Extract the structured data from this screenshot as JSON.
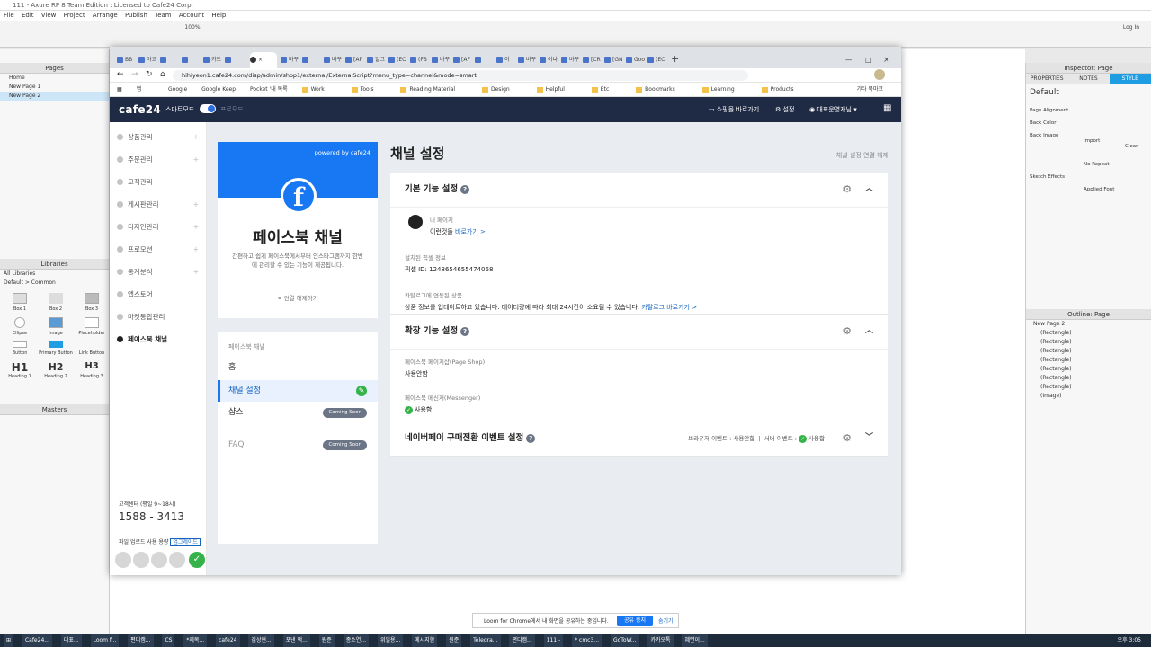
{
  "axure": {
    "title": "111 - Axure RP 8 Team Edition : Licensed to Cafe24 Corp.",
    "menu": [
      "File",
      "Edit",
      "View",
      "Project",
      "Arrange",
      "Publish",
      "Team",
      "Account",
      "Help"
    ],
    "zoom": "100%",
    "log_in": "Log In",
    "pages_header": "Pages",
    "pages": [
      "Home",
      "New Page 1",
      "New Page 2"
    ],
    "libraries_header": "Libraries",
    "all_libraries": "All Libraries",
    "default_common": "Default > Common",
    "widgets": [
      "Box 1",
      "Box 2",
      "Box 3",
      "Ellipse",
      "Image",
      "Placeholder",
      "Button",
      "Primary Button",
      "Link Button",
      "Heading 1",
      "Heading 2",
      "Heading 3"
    ],
    "heading_glyphs": [
      "H1",
      "H2",
      "H3"
    ],
    "masters_header": "Masters",
    "inspector_title": "Inspector: Page",
    "inspector_tabs": [
      "PROPERTIES",
      "NOTES",
      "STYLE"
    ],
    "inspector_default": "Default",
    "page_alignment": "Page Alignment",
    "back_color": "Back Color",
    "back_image": "Back Image",
    "import": "Import",
    "clear": "Clear",
    "no_repeat": "No Repeat",
    "sketch_effects": "Sketch Effects",
    "applied_font": "Applied Font",
    "outline_title": "Outline: Page",
    "outline_page": "New Page 2",
    "outline_items": [
      "(Rectangle)",
      "(Rectangle)",
      "(Rectangle)",
      "(Rectangle)",
      "(Rectangle)",
      "(Rectangle)",
      "(Rectangle)",
      "(Image)"
    ]
  },
  "browser": {
    "url": "hihiyeon1.cafe24.com/disp/admin/shop1/external/ExternalScript?menu_type=channel&mode=smart",
    "bookmarks": [
      "앱",
      "Google",
      "Google Keep",
      "Pocket '내 목록",
      "Work",
      "Tools",
      "Reading Material",
      "Design",
      "Helpful",
      "Etc",
      "Bookmarks",
      "Learning",
      "Products"
    ],
    "other_bookmarks": "기타 북마크",
    "tabs": [
      "BB",
      "아고",
      "",
      "",
      "카드",
      "",
      "바꾸",
      "",
      "바꾸",
      "[AF",
      "알그",
      "(EC",
      "(FB",
      "바꾸",
      "[AF",
      "",
      "이",
      "바꾸",
      "이냐",
      "바꾸",
      "[CR",
      "[GN",
      "Goo",
      "(EC"
    ]
  },
  "cafe24": {
    "logo": "cafe24",
    "smart_mode": "스마트모드",
    "pro_mode": "프로모드",
    "shop_link": "쇼핑몰 바로가기",
    "settings": "설정",
    "admin": "대표운영자님",
    "sidebar": [
      "상품관리",
      "주문관리",
      "고객관리",
      "게시판관리",
      "디자인관리",
      "프로모션",
      "통계분석",
      "앱스토어",
      "마켓통합관리",
      "페이스북 채널"
    ],
    "cs_label": "고객센터 (평일 9~18시)",
    "cs_number": "1588 - 3413",
    "upload_label": "파일 업로드 사용 용량",
    "upgrade": "업그레이드",
    "fb_powered": "powered by cafe24",
    "fb_title": "페이스북 채널",
    "fb_desc": "간편하고 쉽게 페이스북에서부터 인스타그램까지 한번에 관리할 수 있는 기능이 제공됩니다.",
    "fb_disconnect": "연결 해제하기",
    "nav_header": "페이스북 채널",
    "nav": [
      {
        "label": "홈",
        "badge": ""
      },
      {
        "label": "채널 설정",
        "badge": ""
      },
      {
        "label": "샵스",
        "badge": "Coming Soon"
      },
      {
        "label": "FAQ",
        "badge": "Coming Soon"
      }
    ],
    "page_title": "채널 설정",
    "disconnect_channel": "채널 설정 연결 해제",
    "basic_title": "기본 기능 설정",
    "my_page_label": "내 페이지",
    "my_page_name": "이런것들",
    "go_link": "바로가기 >",
    "pixel_label": "설치된 픽셀 정보",
    "pixel_id": "픽셀 ID: 1248654655474068",
    "catalog_label": "카탈로그에 연동된 상품",
    "catalog_text": "상품 정보를 업데이트하고 있습니다. 데이터량에 따라 최대 24시간이 소요될 수 있습니다.",
    "catalog_link": "카탈로그 바로가기 >",
    "ext_title": "확장 기능 설정",
    "shop_label": "페이스북 페이지샵(Page Shop)",
    "shop_value": "사용안함",
    "messenger_label": "페이스북 메신저(Messenger)",
    "messenger_value": "사용함",
    "naverpay_title": "네이버페이 구매전환 이벤트 설정",
    "browser_event": "브라우저 이벤트 : 사용안함",
    "server_event": "서버 이벤트 :",
    "server_value": "사용함"
  },
  "loom": {
    "message": "Loom for Chrome에서 내 화면을 공유하는 중입니다.",
    "stop": "공유 중지",
    "hide": "숨기기"
  },
  "taskbar": [
    "Cafe24...",
    "대표...",
    "Loom f...",
    "",
    "",
    "",
    "편디캠...",
    "CS",
    "*제목...",
    "cafe24",
    "김상현...",
    "포낸 퍽...",
    "원준",
    "종소연...",
    "위일용...",
    "메시지함",
    "원준",
    "Telegra...",
    "편디캠...",
    "111 -",
    "* cmc3...",
    "GoToW...",
    "카카오톡",
    "혜연이...",
    "오후 3:05"
  ]
}
